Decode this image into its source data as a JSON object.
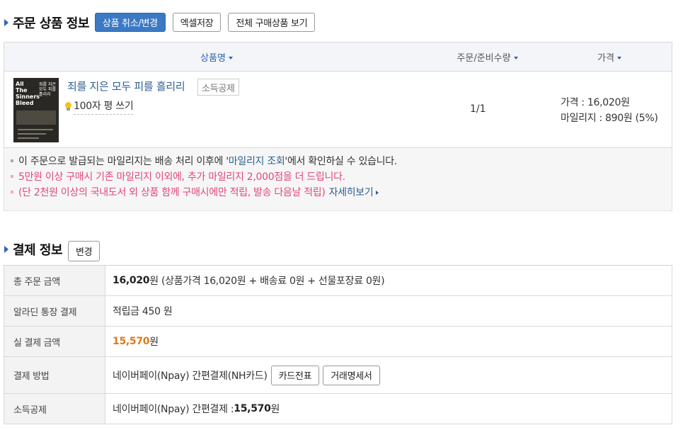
{
  "order_section": {
    "title": "주문 상품 정보",
    "btn_cancel": "상품 취소/변경",
    "btn_excel": "엑셀저장",
    "btn_all": "전체 구매상품 보기"
  },
  "table_headers": {
    "name": "상품명",
    "qty": "주문/준비수량",
    "price": "가격"
  },
  "item": {
    "cover_title": "All The Sinners Bleed",
    "cover_kr": "죄를 지은 모두 피를 흘리리",
    "title": "죄를 지은 모두 피를 흘리리",
    "badge": "소득공제",
    "review_link": "100자 평 쓰기",
    "qty": "1/1",
    "price": "가격 : 16,020원",
    "mileage": "마일리지 : 890원 (5%)"
  },
  "notices": {
    "line1_pre": "이 주문으로 발급되는 마일리지는 배송 처리 이후에 '",
    "line1_link": "마일리지 조회",
    "line1_post": "'에서 확인하실 수 있습니다.",
    "line2": "5만원 이상 구매시 기존 마일리지 이외에, 추가 마일리지 2,000점을 더 드립니다.",
    "line3": "(단 2천원 이상의 국내도서 외 상품 함께 구매시에만 적립, 발송 다음날 적립)",
    "more": "자세히보기"
  },
  "payment_section": {
    "title": "결제 정보",
    "btn_change": "변경"
  },
  "payment": {
    "total_label": "총 주문 금액",
    "total_amount": "16,020",
    "total_rest": " 원 (상품가격 16,020원 + 배송료 0원 + 선물포장료 0원)",
    "bank_label": "알라딘 통장 결제",
    "bank_value": "적립금 450 원",
    "actual_label": "실 결제 금액",
    "actual_amount": "15,570",
    "actual_unit": " 원",
    "method_label": "결제 방법",
    "method_value": "네이버페이(Npay) 간편결제(NH카드)",
    "btn_card": "카드전표",
    "btn_stmt": "거래명세서",
    "deduction_label": "소득공제",
    "deduction_pre": "네이버페이(Npay) 간편결제 : ",
    "deduction_amount": "15,570",
    "deduction_unit": "원"
  },
  "colors": {
    "accent_blue": "#3c79c4",
    "link_blue": "#2b5f93",
    "pink": "#e2487b",
    "orange": "#e07a1b"
  }
}
